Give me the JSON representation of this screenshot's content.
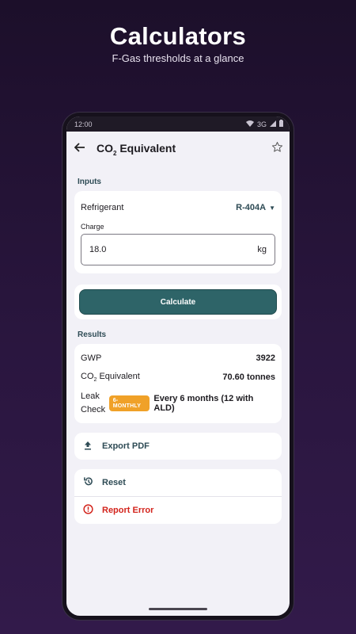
{
  "promo": {
    "title": "Calculators",
    "subtitle": "F-Gas thresholds at a glance"
  },
  "status_bar": {
    "time": "12:00",
    "network": "3G"
  },
  "appbar": {
    "back_icon": "arrow-left-icon",
    "title_prefix": "CO",
    "title_sub": "2",
    "title_suffix": " Equivalent",
    "favorite_icon": "star-outline-icon"
  },
  "inputs": {
    "section_label": "Inputs",
    "refrigerant_label": "Refrigerant",
    "refrigerant_value": "R-404A",
    "charge_label": "Charge",
    "charge_value": "18.0",
    "charge_unit": "kg"
  },
  "calculate_label": "Calculate",
  "results": {
    "section_label": "Results",
    "gwp_label": "GWP",
    "gwp_value": "3922",
    "co2_label_prefix": "CO",
    "co2_label_sub": "2",
    "co2_label_suffix": " Equivalent",
    "co2_value": "70.60 tonnes",
    "leak_label": "Leak Check",
    "leak_badge": "6-MONTHLY",
    "leak_value": "Every 6 months (12 with ALD)"
  },
  "actions": {
    "export_label": "Export PDF",
    "reset_label": "Reset",
    "report_label": "Report Error"
  },
  "colors": {
    "accent": "#2e6468",
    "badge": "#f0a128",
    "error": "#d3241c"
  }
}
